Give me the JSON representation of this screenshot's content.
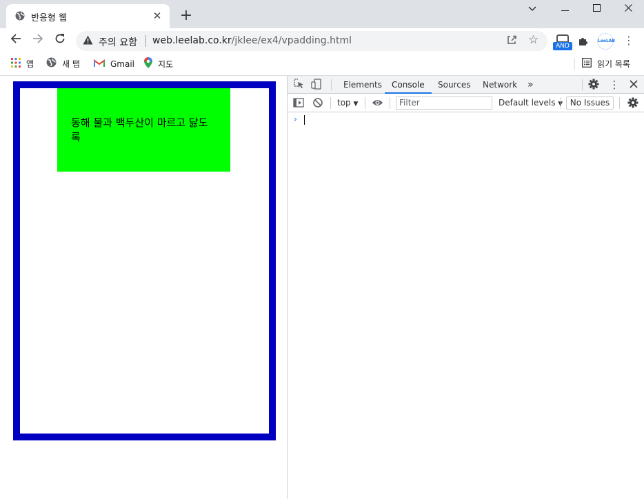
{
  "browser": {
    "tab_title": "반응형 웹",
    "tab_close": "✕",
    "new_tab": "+",
    "window_controls": {
      "minimize": "—",
      "maximize": "☐",
      "close": "✕",
      "dropdown": "⌄"
    },
    "address": {
      "security_label": "주의 요함",
      "url_host": "web.leelab.co.kr",
      "url_path": "/jklee/ex4/vpadding.html"
    },
    "extensions": {
      "and_badge": "AND",
      "leelab_label": "LeeLAB"
    },
    "bookmarks": [
      {
        "label": "앱"
      },
      {
        "label": "새 탭"
      },
      {
        "label": "Gmail"
      },
      {
        "label": "지도"
      }
    ],
    "reading_list": "읽기 목록"
  },
  "page": {
    "green_box_text": "동해 물과 백두산이 마르고 닳도록",
    "colors": {
      "blue_border": "#0000c0",
      "green_fill": "#00ff00"
    }
  },
  "devtools": {
    "tabs": [
      "Elements",
      "Console",
      "Sources",
      "Network"
    ],
    "active_tab": "Console",
    "more_tabs": "»",
    "context": "top",
    "filter_placeholder": "Filter",
    "levels": "Default levels",
    "issues": "No Issues",
    "prompt": "›"
  }
}
